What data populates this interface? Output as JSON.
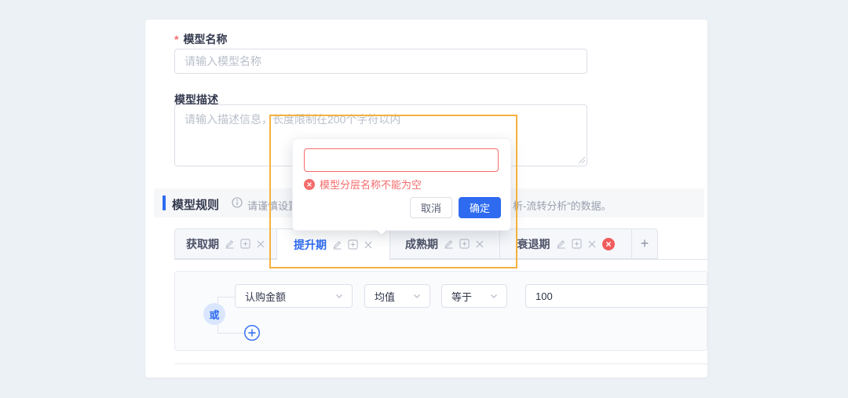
{
  "colors": {
    "accent": "#2e6bf0",
    "error": "#f56c6c",
    "highlight": "#f4b13e",
    "page_background": "#ecf1f6"
  },
  "form": {
    "name_label": "模型名称",
    "name_required_mark": "*",
    "name_placeholder": "请输入模型名称",
    "desc_label": "模型描述",
    "desc_placeholder": "请输入描述信息，长度限制在200个字符以内"
  },
  "section": {
    "title": "模型规则",
    "hint_prefix": "请谨慎设置",
    "hint_suffix": "析-流转分析”的数据。"
  },
  "popover": {
    "input_value": "",
    "error_text": "模型分层名称不能为空",
    "cancel_label": "取消",
    "confirm_label": "确定"
  },
  "tabs": [
    {
      "label": "获取期",
      "active": false,
      "error": false
    },
    {
      "label": "提升期",
      "active": true,
      "error": false
    },
    {
      "label": "成熟期",
      "active": false,
      "error": false
    },
    {
      "label": "衰退期",
      "active": false,
      "error": true
    }
  ],
  "tabs_add_label": "+",
  "rule": {
    "logic_label": "或",
    "field_value": "认购金额",
    "agg_value": "均值",
    "op_value": "等于",
    "value": "100"
  }
}
